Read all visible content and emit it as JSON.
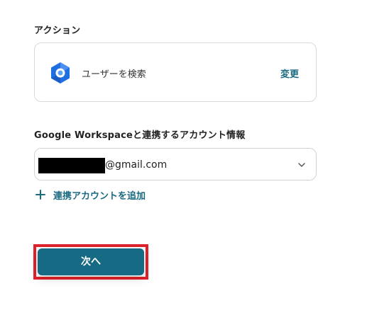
{
  "action_section": {
    "label": "アクション",
    "action_name": "ユーザーを検索",
    "change_label": "変更",
    "icon": "google-workspace-hexagon-icon"
  },
  "account_section": {
    "label": "Google Workspaceと連携するアカウント情報",
    "selected_account_visible": "@gmail.com",
    "add_account_label": "連携アカウントを追加"
  },
  "next_button": {
    "label": "次へ"
  },
  "colors": {
    "accent": "#1c6a82",
    "button_bg": "#166a83",
    "highlight": "#e0232b",
    "google_blue": "#1f6fe0",
    "google_light_blue": "#5aa2f7"
  }
}
